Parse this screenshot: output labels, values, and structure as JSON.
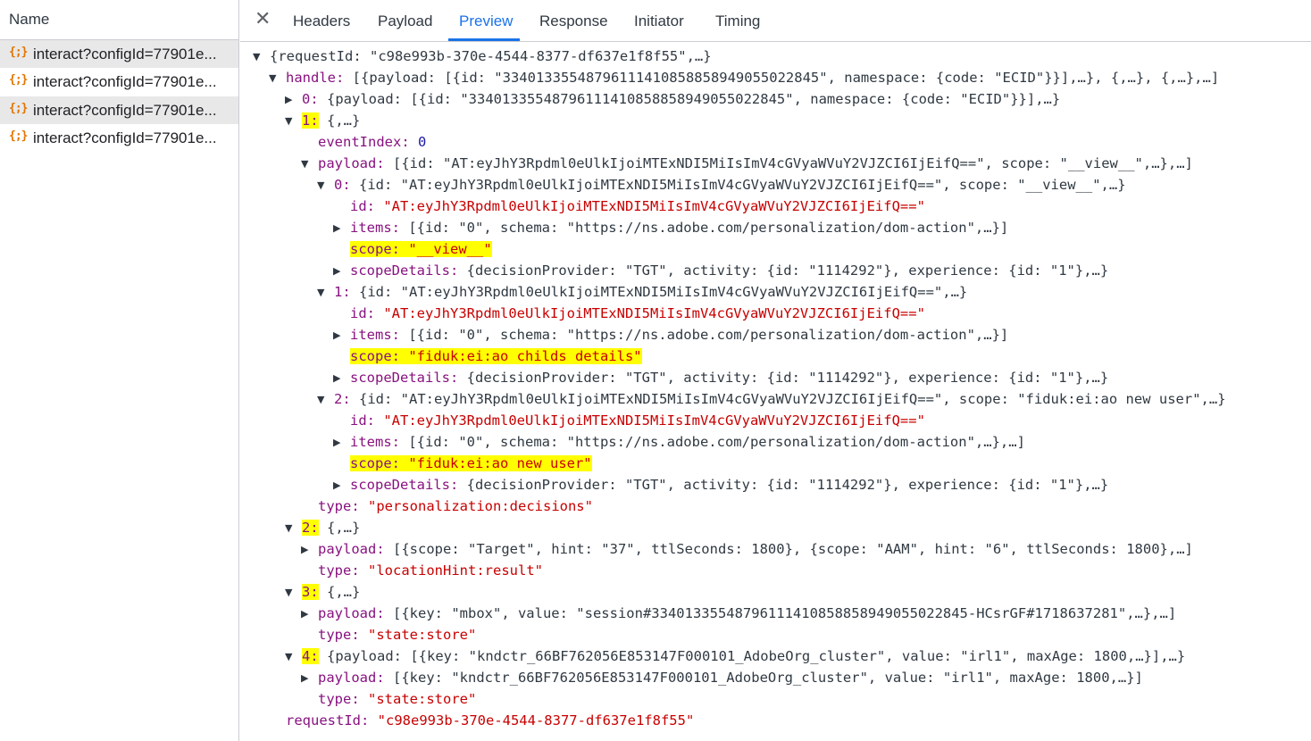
{
  "left_panel": {
    "header": "Name",
    "icon_glyph": "{;}",
    "requests": [
      {
        "name": "interact?configId=77901e...",
        "selected": true
      },
      {
        "name": "interact?configId=77901e...",
        "selected": false
      },
      {
        "name": "interact?configId=77901e...",
        "selected": true
      },
      {
        "name": "interact?configId=77901e...",
        "selected": false
      }
    ]
  },
  "tabs": {
    "close_icon": "✕",
    "items": [
      "Headers",
      "Payload",
      "Preview",
      "Response",
      "Initiator",
      "Timing"
    ],
    "active": "Preview"
  },
  "tree": [
    {
      "indent": 0,
      "tri": "down",
      "text": "{requestId: \"c98e993b-370e-4544-8377-df637e1f8f55\",…}"
    },
    {
      "indent": 1,
      "tri": "down",
      "key": "handle",
      "text": "[{payload: [{id: \"33401335548796111410858858949055022845\", namespace: {code: \"ECID\"}}],…}, {,…}, {,…},…]"
    },
    {
      "indent": 2,
      "tri": "right",
      "key": "0",
      "text": "{payload: [{id: \"33401335548796111410858858949055022845\", namespace: {code: \"ECID\"}}],…}"
    },
    {
      "indent": 2,
      "tri": "down",
      "key": "1",
      "text": "{,…}",
      "hl": true
    },
    {
      "indent": 3,
      "key": "eventIndex",
      "num": "0"
    },
    {
      "indent": 3,
      "tri": "down",
      "key": "payload",
      "text": "[{id: \"AT:eyJhY3Rpdml0eUlkIjoiMTExNDI5MiIsImV4cGVyaWVuY2VJZCI6IjEifQ==\", scope: \"__view__\",…},…]"
    },
    {
      "indent": 4,
      "tri": "down",
      "key": "0",
      "text": "{id: \"AT:eyJhY3Rpdml0eUlkIjoiMTExNDI5MiIsImV4cGVyaWVuY2VJZCI6IjEifQ==\", scope: \"__view__\",…}"
    },
    {
      "indent": 5,
      "key": "id",
      "str": "\"AT:eyJhY3Rpdml0eUlkIjoiMTExNDI5MiIsImV4cGVyaWVuY2VJZCI6IjEifQ==\""
    },
    {
      "indent": 5,
      "tri": "right",
      "key": "items",
      "text": "[{id: \"0\", schema: \"https://ns.adobe.com/personalization/dom-action\",…}]"
    },
    {
      "indent": 5,
      "key": "scope",
      "str": "\"__view__\"",
      "hl": true
    },
    {
      "indent": 5,
      "tri": "right",
      "key": "scopeDetails",
      "text": "{decisionProvider: \"TGT\", activity: {id: \"1114292\"}, experience: {id: \"1\"},…}"
    },
    {
      "indent": 4,
      "tri": "down",
      "key": "1",
      "text": "{id: \"AT:eyJhY3Rpdml0eUlkIjoiMTExNDI5MiIsImV4cGVyaWVuY2VJZCI6IjEifQ==\",…}"
    },
    {
      "indent": 5,
      "key": "id",
      "str": "\"AT:eyJhY3Rpdml0eUlkIjoiMTExNDI5MiIsImV4cGVyaWVuY2VJZCI6IjEifQ==\""
    },
    {
      "indent": 5,
      "tri": "right",
      "key": "items",
      "text": "[{id: \"0\", schema: \"https://ns.adobe.com/personalization/dom-action\",…}]"
    },
    {
      "indent": 5,
      "key": "scope",
      "str": "\"fiduk:ei:ao childs details\"",
      "hl": true
    },
    {
      "indent": 5,
      "tri": "right",
      "key": "scopeDetails",
      "text": "{decisionProvider: \"TGT\", activity: {id: \"1114292\"}, experience: {id: \"1\"},…}"
    },
    {
      "indent": 4,
      "tri": "down",
      "key": "2",
      "text": "{id: \"AT:eyJhY3Rpdml0eUlkIjoiMTExNDI5MiIsImV4cGVyaWVuY2VJZCI6IjEifQ==\", scope: \"fiduk:ei:ao new user\",…}"
    },
    {
      "indent": 5,
      "key": "id",
      "str": "\"AT:eyJhY3Rpdml0eUlkIjoiMTExNDI5MiIsImV4cGVyaWVuY2VJZCI6IjEifQ==\""
    },
    {
      "indent": 5,
      "tri": "right",
      "key": "items",
      "text": "[{id: \"0\", schema: \"https://ns.adobe.com/personalization/dom-action\",…},…]"
    },
    {
      "indent": 5,
      "key": "scope",
      "str": "\"fiduk:ei:ao new user\"",
      "hl": true
    },
    {
      "indent": 5,
      "tri": "right",
      "key": "scopeDetails",
      "text": "{decisionProvider: \"TGT\", activity: {id: \"1114292\"}, experience: {id: \"1\"},…}"
    },
    {
      "indent": 3,
      "key": "type",
      "str": "\"personalization:decisions\""
    },
    {
      "indent": 2,
      "tri": "down",
      "key": "2",
      "text": "{,…}",
      "hl": true
    },
    {
      "indent": 3,
      "tri": "right",
      "key": "payload",
      "text": "[{scope: \"Target\", hint: \"37\", ttlSeconds: 1800}, {scope: \"AAM\", hint: \"6\", ttlSeconds: 1800},…]"
    },
    {
      "indent": 3,
      "key": "type",
      "str": "\"locationHint:result\""
    },
    {
      "indent": 2,
      "tri": "down",
      "key": "3",
      "text": "{,…}",
      "hl": true
    },
    {
      "indent": 3,
      "tri": "right",
      "key": "payload",
      "text": "[{key: \"mbox\", value: \"session#33401335548796111410858858949055022845-HCsrGF#1718637281\",…},…]"
    },
    {
      "indent": 3,
      "key": "type",
      "str": "\"state:store\""
    },
    {
      "indent": 2,
      "tri": "down",
      "key": "4",
      "text": "{payload: [{key: \"kndctr_66BF762056E853147F000101_AdobeOrg_cluster\", value: \"irl1\", maxAge: 1800,…}],…}",
      "hl": true
    },
    {
      "indent": 3,
      "tri": "right",
      "key": "payload",
      "text": "[{key: \"kndctr_66BF762056E853147F000101_AdobeOrg_cluster\", value: \"irl1\", maxAge: 1800,…}]"
    },
    {
      "indent": 3,
      "key": "type",
      "str": "\"state:store\""
    },
    {
      "indent": 1,
      "key": "requestId",
      "str": "\"c98e993b-370e-4544-8377-df637e1f8f55\""
    }
  ]
}
